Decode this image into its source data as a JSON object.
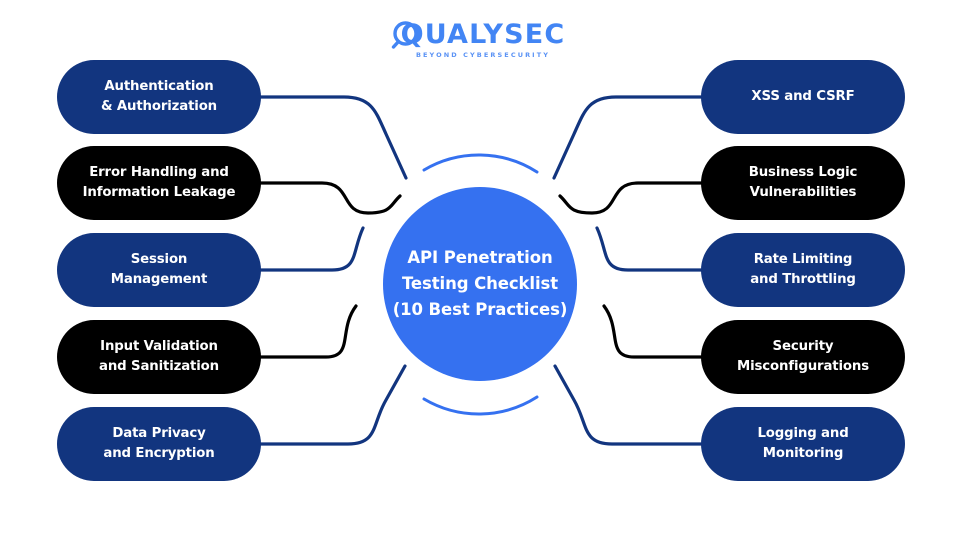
{
  "brand": {
    "logo_word": "QUALYSEC",
    "logo_tagline": "BEYOND CYBERSECURITY",
    "logo_icon": "magnifier-q-logo-icon"
  },
  "center": {
    "line1": "API Penetration",
    "line2": "Testing Checklist",
    "line3": "(10 Best Practices)",
    "color": "#3571F0"
  },
  "colors": {
    "navy": "#12357F",
    "black": "#000000",
    "accent_blue": "#3571F0",
    "logo_blue": "#4285F4",
    "background": "#FFFFFF"
  },
  "left_nodes": [
    {
      "line1": "Authentication",
      "line2": "& Authorization",
      "style": "navy"
    },
    {
      "line1": "Error Handling and",
      "line2": "Information Leakage",
      "style": "black"
    },
    {
      "line1": "Session",
      "line2": "Management",
      "style": "navy"
    },
    {
      "line1": "Input Validation",
      "line2": "and Sanitization",
      "style": "black"
    },
    {
      "line1": "Data Privacy",
      "line2": "and Encryption",
      "style": "navy"
    }
  ],
  "right_nodes": [
    {
      "line1": "XSS and CSRF",
      "line2": "",
      "style": "navy"
    },
    {
      "line1": "Business Logic",
      "line2": "Vulnerabilities",
      "style": "black"
    },
    {
      "line1": "Rate Limiting",
      "line2": "and Throttling",
      "style": "navy"
    },
    {
      "line1": "Security",
      "line2": "Misconfigurations",
      "style": "black"
    },
    {
      "line1": "Logging and",
      "line2": "Monitoring",
      "style": "navy"
    }
  ]
}
